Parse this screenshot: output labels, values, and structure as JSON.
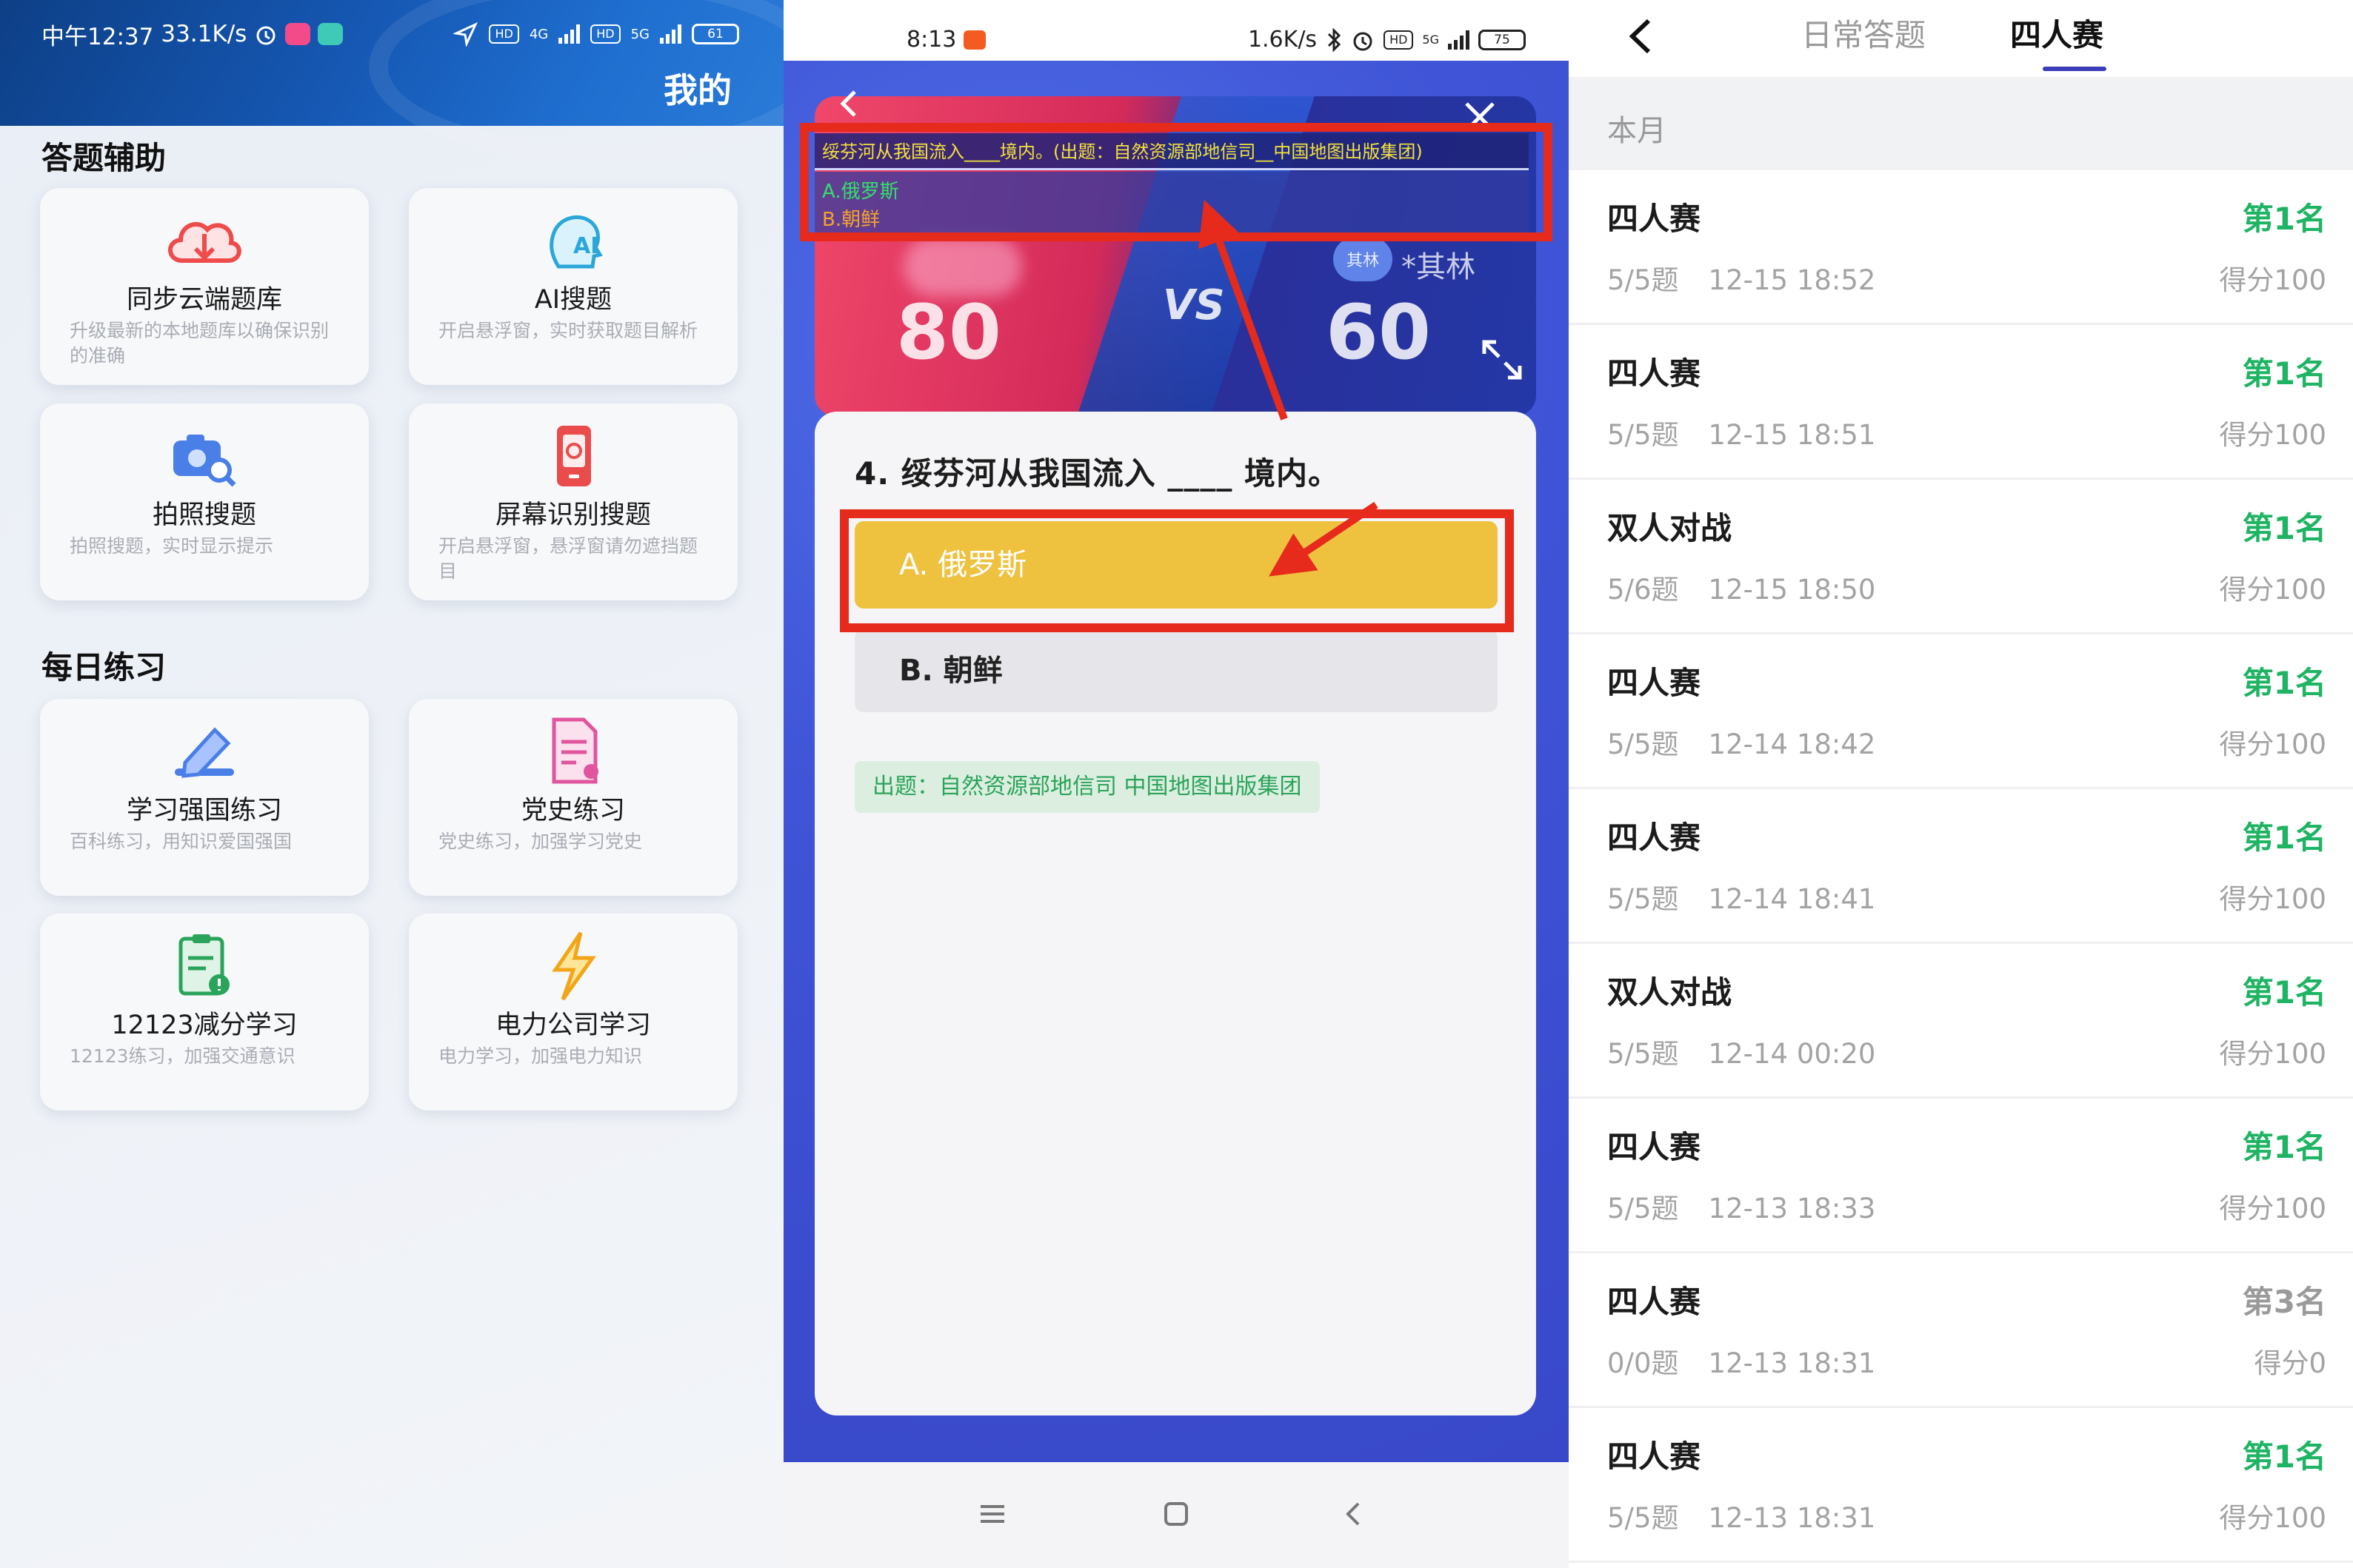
{
  "panel1": {
    "status": {
      "time": "中午12:37",
      "speed": "33.1K/s",
      "hd1": "HD",
      "net1": "4G",
      "hd2": "HD",
      "net2": "5G",
      "battery": "61"
    },
    "title": "我的",
    "section1": "答题辅助",
    "section2": "每日练习",
    "cards": [
      {
        "title": "同步云端题库",
        "desc": "升级最新的本地题库以确保识别的准确",
        "icon": "cloud-download-icon"
      },
      {
        "title": "AI搜题",
        "desc": "开启悬浮窗，实时获取题目解析",
        "icon": "ai-head-icon"
      },
      {
        "title": "拍照搜题",
        "desc": "拍照搜题，实时显示提示",
        "icon": "camera-search-icon"
      },
      {
        "title": "屏幕识别搜题",
        "desc": "开启悬浮窗，悬浮窗请勿遮挡题目",
        "icon": "phone-scan-icon"
      },
      {
        "title": "学习强国练习",
        "desc": "百科练习，用知识爱国强国",
        "icon": "pencil-icon"
      },
      {
        "title": "党史练习",
        "desc": "党史练习，加强学习党史",
        "icon": "document-icon"
      },
      {
        "title": "12123减分学习",
        "desc": "12123练习，加强交通意识",
        "icon": "clipboard-alert-icon"
      },
      {
        "title": "电力公司学习",
        "desc": "电力学习，加强电力知识",
        "icon": "lightning-icon"
      }
    ]
  },
  "panel2": {
    "status": {
      "time": "8:13",
      "speed": "1.6K/s",
      "hd": "HD",
      "net": "5G",
      "battery": "75"
    },
    "overlay": {
      "question": "绥芬河从我国流入____境内。(出题：自然资源部地信司__中国地图出版集团)",
      "option_a": "A.俄罗斯",
      "option_b": "B.朝鲜"
    },
    "battle": {
      "left_score": "80",
      "vs": "VS",
      "right_score": "60",
      "opponent_avatar": "其林",
      "opponent_name": "*其林"
    },
    "question": "4. 绥芬河从我国流入 ____ 境内。",
    "option_a": "A. 俄罗斯",
    "option_b": "B. 朝鲜",
    "source": "出题：自然资源部地信司 中国地图出版集团",
    "colors": {
      "highlight": "#e62b1d",
      "option_selected": "#eec23f",
      "source_text": "#2aa45a"
    }
  },
  "panel3": {
    "tabs": [
      "日常答题",
      "四人赛"
    ],
    "active_tab": "四人赛",
    "month_label": "本月",
    "records": [
      {
        "type": "四人赛",
        "progress": "5/5题",
        "time": "12-15 18:52",
        "rank": "第1名",
        "score": "得分100",
        "rank_color": "#1fb463"
      },
      {
        "type": "四人赛",
        "progress": "5/5题",
        "time": "12-15 18:51",
        "rank": "第1名",
        "score": "得分100",
        "rank_color": "#1fb463"
      },
      {
        "type": "双人对战",
        "progress": "5/6题",
        "time": "12-15 18:50",
        "rank": "第1名",
        "score": "得分100",
        "rank_color": "#1fb463"
      },
      {
        "type": "四人赛",
        "progress": "5/5题",
        "time": "12-14 18:42",
        "rank": "第1名",
        "score": "得分100",
        "rank_color": "#1fb463"
      },
      {
        "type": "四人赛",
        "progress": "5/5题",
        "time": "12-14 18:41",
        "rank": "第1名",
        "score": "得分100",
        "rank_color": "#1fb463"
      },
      {
        "type": "双人对战",
        "progress": "5/5题",
        "time": "12-14 00:20",
        "rank": "第1名",
        "score": "得分100",
        "rank_color": "#1fb463"
      },
      {
        "type": "四人赛",
        "progress": "5/5题",
        "time": "12-13 18:33",
        "rank": "第1名",
        "score": "得分100",
        "rank_color": "#1fb463"
      },
      {
        "type": "四人赛",
        "progress": "0/0题",
        "time": "12-13 18:31",
        "rank": "第3名",
        "score": "得分0",
        "rank_color": "#9a9a9a"
      },
      {
        "type": "四人赛",
        "progress": "5/5题",
        "time": "12-13 18:31",
        "rank": "第1名",
        "score": "得分100",
        "rank_color": "#1fb463"
      }
    ]
  }
}
